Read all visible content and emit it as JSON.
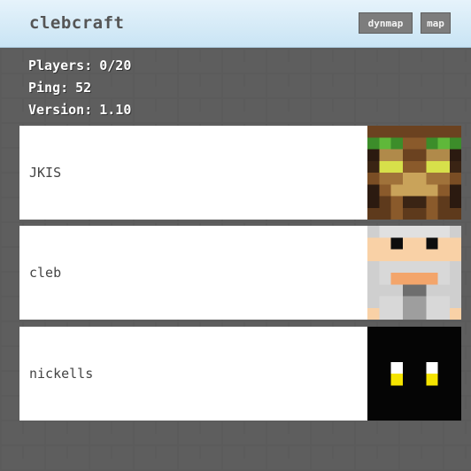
{
  "header": {
    "title": "clebcraft",
    "buttons": {
      "dynmap": "dynmap",
      "map": "map"
    }
  },
  "stats": {
    "players_label": "Players:",
    "players_value": "0/20",
    "ping_label": "Ping:",
    "ping_value": "52",
    "version_label": "Version:",
    "version_value": "1.10"
  },
  "players": [
    {
      "name": "JKIS",
      "avatar": "green-brown-skin-face-icon"
    },
    {
      "name": "cleb",
      "avatar": "white-beard-skin-face-icon"
    },
    {
      "name": "nickells",
      "avatar": "black-skin-face-icon"
    }
  ],
  "colors": {
    "header_top": "#e6f3fb",
    "header_bottom": "#c9e4f4",
    "button_bg": "#7d7d7d",
    "card_bg": "#ffffff"
  }
}
